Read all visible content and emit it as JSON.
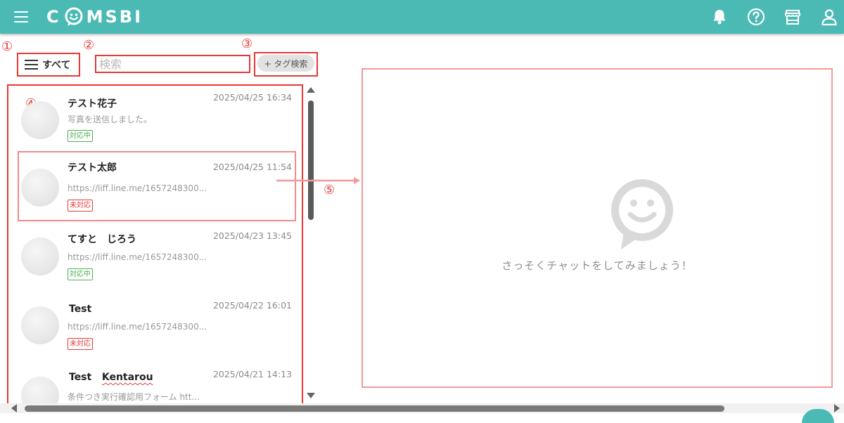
{
  "app": {
    "logo_text_left": "C",
    "logo_text_right": "MSBI",
    "accent": "#4bbab4"
  },
  "header": {
    "icons": [
      "bell-icon",
      "help-icon",
      "shop-icon",
      "user-icon"
    ]
  },
  "annotations": {
    "n1": "①",
    "n2": "②",
    "n3": "③",
    "n4": "④",
    "n5": "⑤"
  },
  "toolbar": {
    "filter_label": "すべて",
    "search_placeholder": "検索",
    "tag_search_label": "+ タグ検索"
  },
  "conversations": [
    {
      "name": "テスト花子",
      "time": "2025/04/25 16:34",
      "preview": "写真を送信しました。",
      "status": "対応中",
      "status_type": "ok"
    },
    {
      "name": "テスト太郎",
      "time": "2025/04/25 11:54",
      "preview": "https://liff.line.me/1657248300...",
      "status": "未対応",
      "status_type": "ng"
    },
    {
      "name": "てすと　じろう",
      "time": "2025/04/23 13:45",
      "preview": "https://liff.line.me/1657248300...",
      "status": "対応中",
      "status_type": "ok"
    },
    {
      "name": "Test",
      "time": "2025/04/22 16:01",
      "preview": "https://liff.line.me/1657248300...",
      "status": "未対応",
      "status_type": "ng"
    },
    {
      "name_part1": "Test",
      "name_part2": "Kentarou",
      "time": "2025/04/21 14:13",
      "preview": "条件つき実行確認用フォーム htt..."
    }
  ],
  "chat": {
    "empty_message": "さっそくチャットをしてみましょう！"
  }
}
